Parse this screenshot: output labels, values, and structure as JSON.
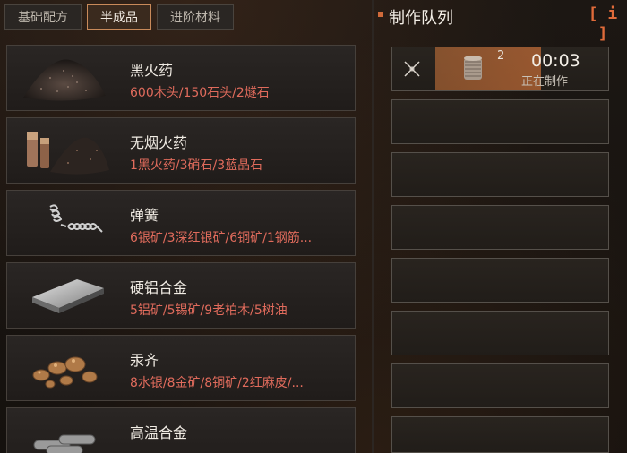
{
  "tabs": [
    {
      "label": "基础配方",
      "active": false
    },
    {
      "label": "半成品",
      "active": true
    },
    {
      "label": "进阶材料",
      "active": false
    }
  ],
  "recipes": [
    {
      "name": "黑火药",
      "materials": "600木头/150石头/2燧石",
      "icon": "black-powder-icon"
    },
    {
      "name": "无烟火药",
      "materials": "1黑火药/3硝石/3蓝晶石",
      "icon": "smokeless-powder-icon"
    },
    {
      "name": "弹簧",
      "materials": "6银矿/3深红银矿/6铜矿/1钢筋...",
      "icon": "spring-icon"
    },
    {
      "name": "硬铝合金",
      "materials": "5铝矿/5锡矿/9老柏木/5树油",
      "icon": "duralumin-icon"
    },
    {
      "name": "汞齐",
      "materials": "8水银/8金矿/8铜矿/2红麻皮/...",
      "icon": "amalgam-icon"
    },
    {
      "name": "高温合金",
      "materials": "",
      "icon": "superalloy-icon"
    }
  ],
  "queue": {
    "title": "制作队列",
    "info_label": "[ i ]",
    "active": {
      "count": "2",
      "timer": "00:03",
      "status": "正在制作",
      "progress": 0.45
    },
    "empty_slots": 7
  },
  "colors": {
    "accent": "#d06a3a",
    "materials_text": "#e06b5c",
    "progress": "#c8743c"
  }
}
